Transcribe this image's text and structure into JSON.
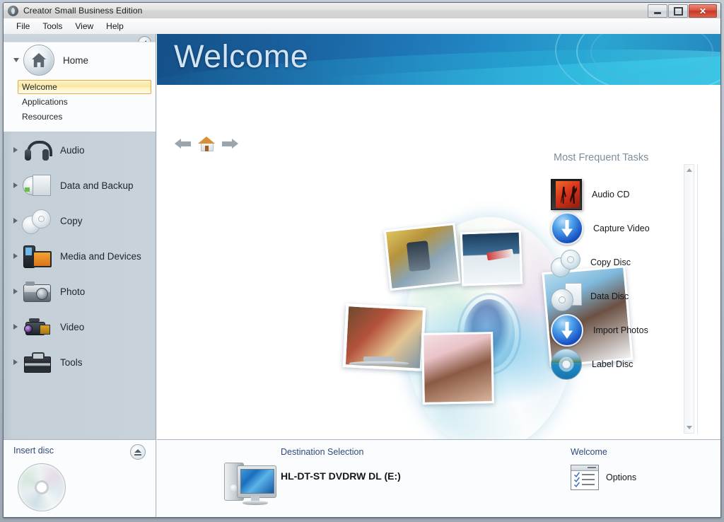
{
  "window": {
    "title": "Creator Small Business Edition",
    "app_icon": "disc-app-icon",
    "controls": {
      "minimize": "Minimize",
      "maximize": "Maximize",
      "close": "Close"
    }
  },
  "menu": {
    "items": [
      "File",
      "Tools",
      "View",
      "Help"
    ]
  },
  "sidebar": {
    "collapse_icon": "collapse-left-icon",
    "groups": [
      {
        "label": "Home",
        "icon": "home-icon",
        "expanded": true,
        "items": [
          {
            "label": "Welcome",
            "active": true
          },
          {
            "label": "Applications",
            "active": false
          },
          {
            "label": "Resources",
            "active": false
          }
        ]
      },
      {
        "label": "Audio",
        "icon": "headphones-icon",
        "expanded": false
      },
      {
        "label": "Data and Backup",
        "icon": "disc-folder-icon",
        "expanded": false
      },
      {
        "label": "Copy",
        "icon": "two-discs-icon",
        "expanded": false
      },
      {
        "label": "Media and Devices",
        "icon": "phone-device-icon",
        "expanded": false
      },
      {
        "label": "Photo",
        "icon": "camera-icon",
        "expanded": false
      },
      {
        "label": "Video",
        "icon": "camcorder-icon",
        "expanded": false
      },
      {
        "label": "Tools",
        "icon": "toolbox-icon",
        "expanded": false
      }
    ]
  },
  "insert_disc": {
    "label": "Insert disc",
    "eject_icon": "eject-icon",
    "disc_icon": "blank-disc-icon"
  },
  "banner": {
    "title": "Welcome"
  },
  "nav": {
    "back_icon": "back-arrow-icon",
    "home_icon": "home-house-icon",
    "forward_icon": "forward-arrow-icon"
  },
  "hero": {
    "image_name": "disc-media-collage"
  },
  "scrollbar": {
    "up_icon": "scroll-up-icon",
    "down_icon": "scroll-down-icon"
  },
  "tasks": {
    "title": "Most Frequent Tasks",
    "items": [
      {
        "label": "Audio CD",
        "icon": "audio-cd-case-icon"
      },
      {
        "label": "Capture Video",
        "icon": "blue-download-orb-icon"
      },
      {
        "label": "Copy Disc",
        "icon": "two-discs-icon"
      },
      {
        "label": "Data Disc",
        "icon": "disc-document-icon"
      },
      {
        "label": "Import Photos",
        "icon": "blue-download-orb-icon"
      },
      {
        "label": "Label Disc",
        "icon": "photo-disc-icon"
      }
    ]
  },
  "status": {
    "destination": {
      "header": "Destination Selection",
      "device": "HL-DT-ST DVDRW DL (E:)",
      "icon": "computer-monitor-icon"
    },
    "welcome": {
      "header": "Welcome",
      "options_label": "Options",
      "options_icon": "checklist-window-icon"
    }
  },
  "colors": {
    "banner_blue": "#1b63a8",
    "accent_link": "#2d4a7a",
    "highlight_yellow": "#fbe49a",
    "highlight_border": "#e6ab3c",
    "sidebar_bg": "#c8d2da",
    "task_header": "#7d8e9e"
  }
}
